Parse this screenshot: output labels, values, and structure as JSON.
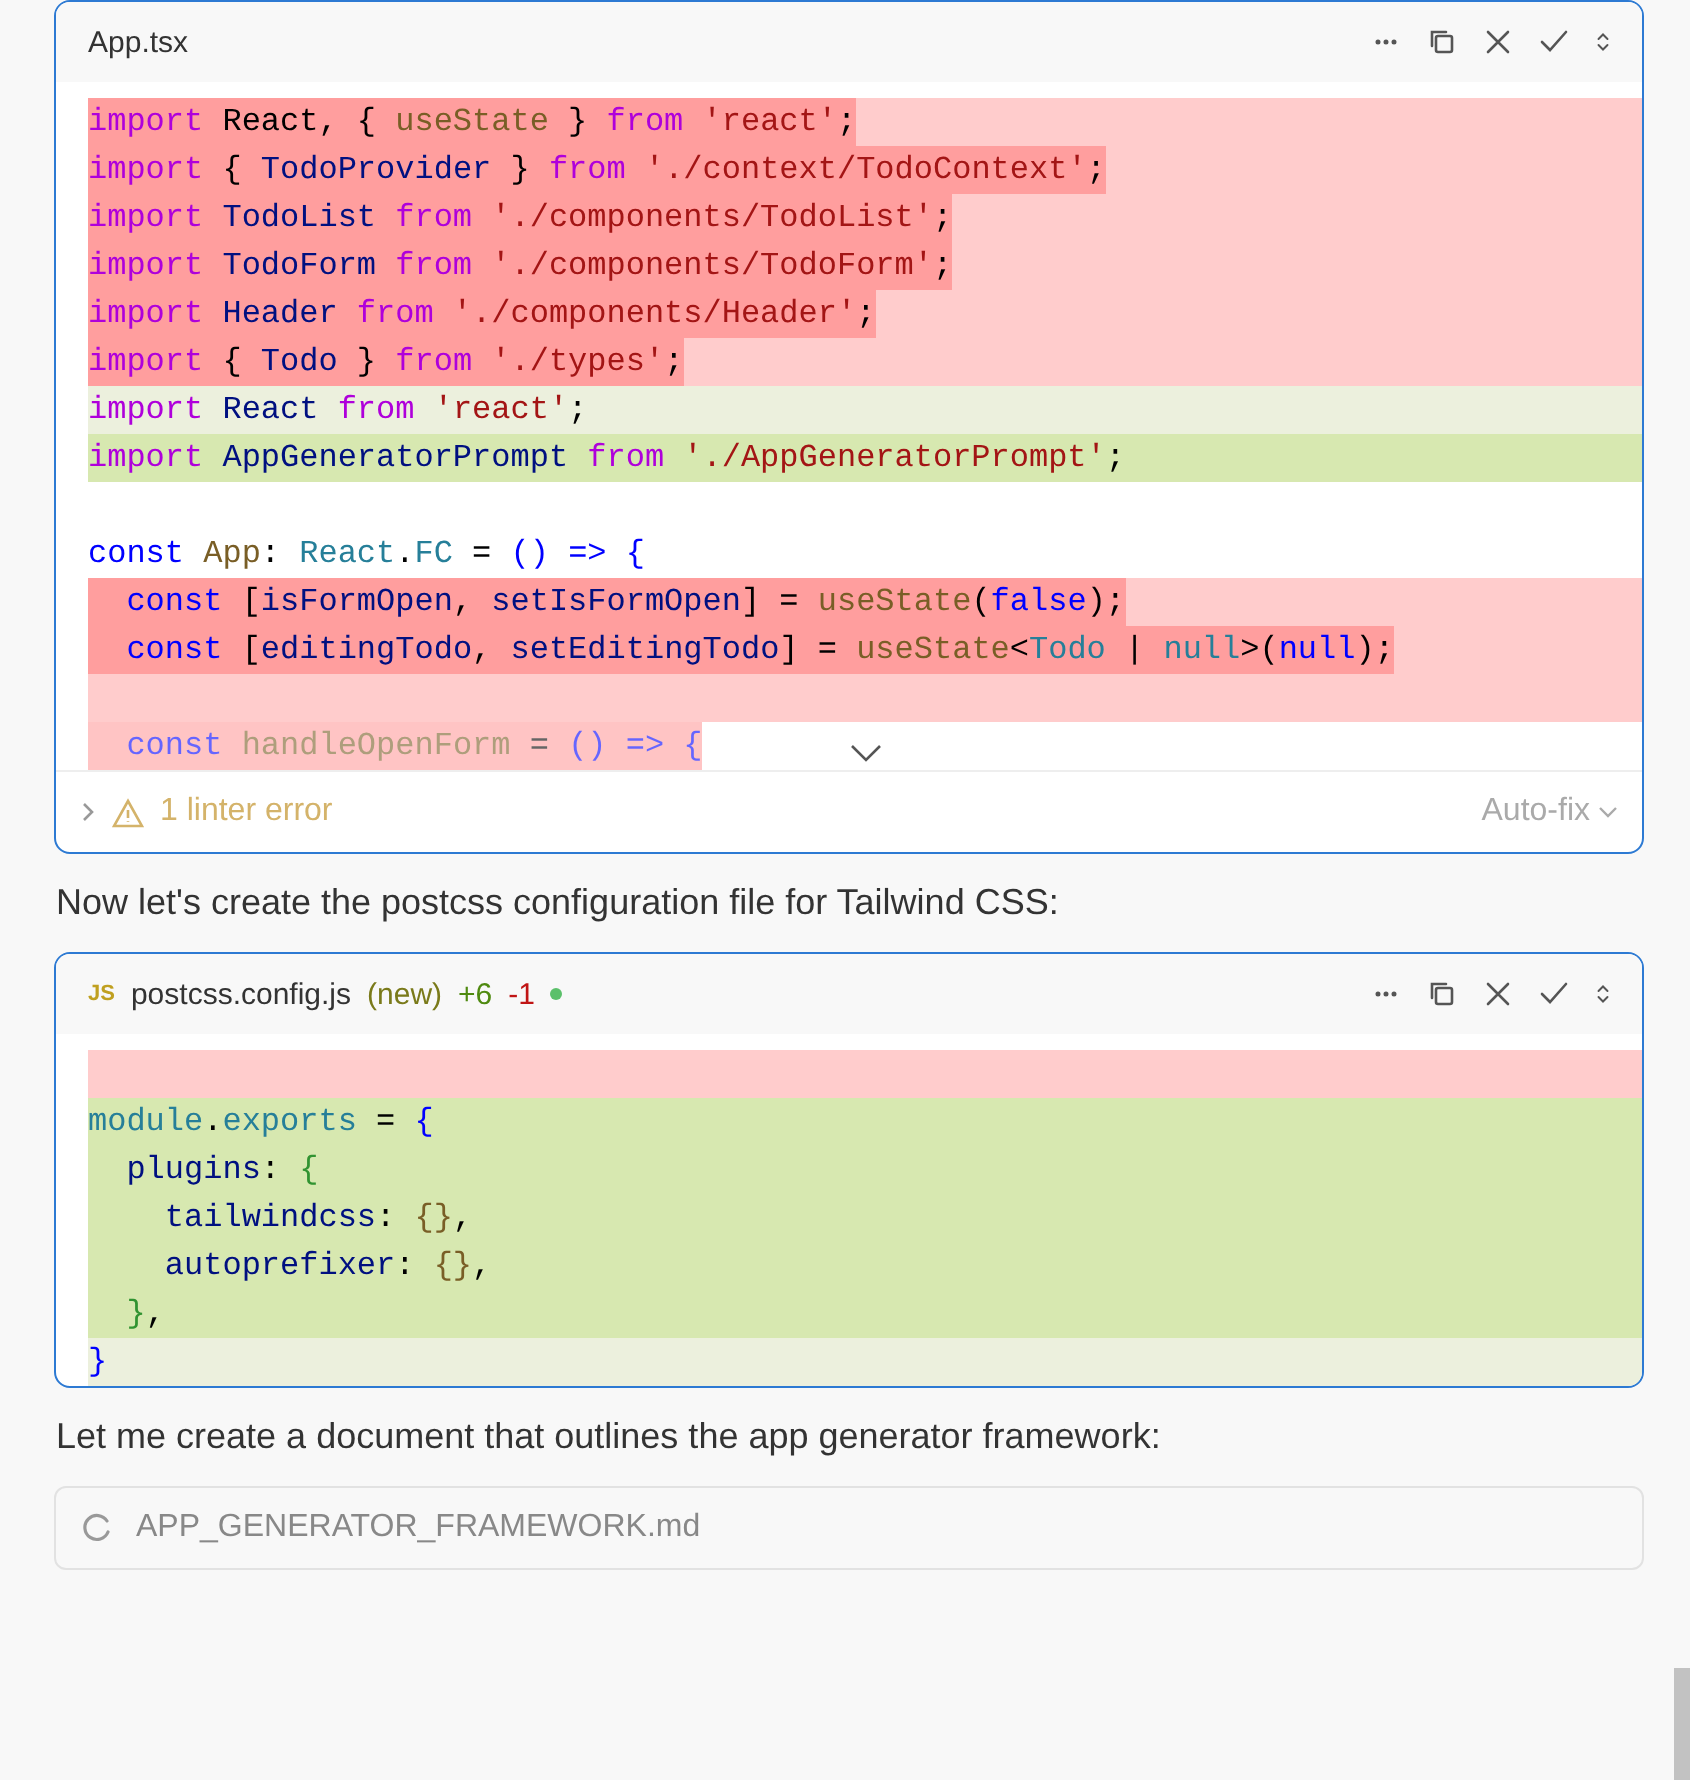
{
  "cards": [
    {
      "file": {
        "name": "App.tsx"
      },
      "lines": [
        {
          "kind": "removed",
          "tokens": [
            {
              "kind": "kw",
              "text": "import"
            },
            {
              "kind": "punc",
              "text": " React, { "
            },
            {
              "kind": "fn",
              "text": "useState"
            },
            {
              "kind": "punc",
              "text": " } "
            },
            {
              "kind": "kw",
              "text": "from"
            },
            {
              "kind": "str",
              "text": " 'react'"
            },
            {
              "kind": "punc",
              "text": ";"
            }
          ]
        },
        {
          "kind": "removed",
          "tokens": [
            {
              "kind": "kw",
              "text": "import"
            },
            {
              "kind": "punc",
              "text": " { "
            },
            {
              "kind": "id",
              "text": "TodoProvider"
            },
            {
              "kind": "punc",
              "text": " } "
            },
            {
              "kind": "kw",
              "text": "from"
            },
            {
              "kind": "str",
              "text": " './context/TodoContext'"
            },
            {
              "kind": "punc",
              "text": ";"
            }
          ]
        },
        {
          "kind": "removed",
          "tokens": [
            {
              "kind": "kw",
              "text": "import"
            },
            {
              "kind": "id",
              "text": " TodoList "
            },
            {
              "kind": "kw",
              "text": "from"
            },
            {
              "kind": "str",
              "text": " './components/TodoList'"
            },
            {
              "kind": "punc",
              "text": ";"
            }
          ]
        },
        {
          "kind": "removed",
          "tokens": [
            {
              "kind": "kw",
              "text": "import"
            },
            {
              "kind": "id",
              "text": " TodoForm "
            },
            {
              "kind": "kw",
              "text": "from"
            },
            {
              "kind": "str",
              "text": " './components/TodoForm'"
            },
            {
              "kind": "punc",
              "text": ";"
            }
          ]
        },
        {
          "kind": "removed",
          "tokens": [
            {
              "kind": "kw",
              "text": "import"
            },
            {
              "kind": "id",
              "text": " Header "
            },
            {
              "kind": "kw",
              "text": "from"
            },
            {
              "kind": "str",
              "text": " './components/Header'"
            },
            {
              "kind": "punc",
              "text": ";"
            }
          ]
        },
        {
          "kind": "removed",
          "tokens": [
            {
              "kind": "kw",
              "text": "import"
            },
            {
              "kind": "punc",
              "text": " { "
            },
            {
              "kind": "id",
              "text": "Todo"
            },
            {
              "kind": "punc",
              "text": " } "
            },
            {
              "kind": "kw",
              "text": "from"
            },
            {
              "kind": "str",
              "text": " './types'"
            },
            {
              "kind": "punc",
              "text": ";"
            }
          ]
        },
        {
          "kind": "modified",
          "tokens": [
            {
              "kind": "kw",
              "text": "import"
            },
            {
              "kind": "id",
              "text": " React "
            },
            {
              "kind": "kw",
              "text": "from"
            },
            {
              "kind": "str",
              "text": " 'react'"
            },
            {
              "kind": "punc",
              "text": ";"
            }
          ]
        },
        {
          "kind": "added",
          "tokens": [
            {
              "kind": "kw",
              "text": "import"
            },
            {
              "kind": "id",
              "text": " AppGeneratorPrompt "
            },
            {
              "kind": "kw",
              "text": "from"
            },
            {
              "kind": "str",
              "text": " './AppGeneratorPrompt'"
            },
            {
              "kind": "punc",
              "text": ";"
            }
          ]
        },
        {
          "kind": "context"
        },
        {
          "kind": "context",
          "tokens": [
            {
              "kind": "key",
              "text": "const"
            },
            {
              "kind": "fn",
              "text": " App"
            },
            {
              "kind": "punc",
              "text": ": "
            },
            {
              "kind": "type",
              "text": "React"
            },
            {
              "kind": "punc",
              "text": "."
            },
            {
              "kind": "type",
              "text": "FC"
            },
            {
              "kind": "punc",
              "text": " = "
            },
            {
              "kind": "key",
              "text": "() =>"
            },
            {
              "kind": "key",
              "text": " {"
            }
          ]
        },
        {
          "kind": "removed",
          "tokens": [
            {
              "kind": "key",
              "text": "  const"
            },
            {
              "kind": "punc",
              "text": " ["
            },
            {
              "kind": "id",
              "text": "isFormOpen"
            },
            {
              "kind": "punc",
              "text": ", "
            },
            {
              "kind": "id",
              "text": "setIsFormOpen"
            },
            {
              "kind": "punc",
              "text": "] = "
            },
            {
              "kind": "fn",
              "text": "useState"
            },
            {
              "kind": "punc",
              "text": "("
            },
            {
              "kind": "key",
              "text": "false"
            },
            {
              "kind": "punc",
              "text": ");"
            }
          ]
        },
        {
          "kind": "removed",
          "tokens": [
            {
              "kind": "key",
              "text": "  const"
            },
            {
              "kind": "punc",
              "text": " ["
            },
            {
              "kind": "id",
              "text": "editingTodo"
            },
            {
              "kind": "punc",
              "text": ", "
            },
            {
              "kind": "id",
              "text": "setEditingTodo"
            },
            {
              "kind": "punc",
              "text": "] = "
            },
            {
              "kind": "fn",
              "text": "useState"
            },
            {
              "kind": "punc",
              "text": "<"
            },
            {
              "kind": "type",
              "text": "Todo"
            },
            {
              "kind": "punc",
              "text": " | "
            },
            {
              "kind": "type",
              "text": "null"
            },
            {
              "kind": "punc",
              "text": ">("
            },
            {
              "kind": "key",
              "text": "null"
            },
            {
              "kind": "punc",
              "text": ");"
            }
          ]
        },
        {
          "kind": "removed"
        },
        {
          "kind": "removed",
          "faded": true,
          "tokens": [
            {
              "kind": "key",
              "text": "  const"
            },
            {
              "kind": "fn",
              "text": " handleOpenForm"
            },
            {
              "kind": "punc",
              "text": " = "
            },
            {
              "kind": "key",
              "text": "() => {"
            }
          ]
        }
      ],
      "footer": {
        "linter": "1 linter error",
        "action": "Auto-fix"
      }
    },
    {
      "file": {
        "badge": "JS",
        "name": "postcss.config.js",
        "status": "(new)",
        "added": "+6",
        "removed": "-1",
        "dot": true
      },
      "lines": [
        {
          "kind": "removed"
        },
        {
          "kind": "added",
          "tokens": [
            {
              "kind": "type",
              "text": "module"
            },
            {
              "kind": "punc",
              "text": "."
            },
            {
              "kind": "type",
              "text": "exports"
            },
            {
              "kind": "punc",
              "text": " = "
            },
            {
              "kind": "key",
              "text": "{"
            }
          ]
        },
        {
          "kind": "added",
          "tokens": [
            {
              "kind": "id",
              "text": "  plugins"
            },
            {
              "kind": "punc",
              "text": ": "
            },
            {
              "kind": "green",
              "text": "{"
            }
          ]
        },
        {
          "kind": "added",
          "tokens": [
            {
              "kind": "id",
              "text": "    tailwindcss"
            },
            {
              "kind": "punc",
              "text": ": "
            },
            {
              "kind": "fn",
              "text": "{}"
            },
            {
              "kind": "punc",
              "text": ","
            }
          ]
        },
        {
          "kind": "added",
          "tokens": [
            {
              "kind": "id",
              "text": "    autoprefixer"
            },
            {
              "kind": "punc",
              "text": ": "
            },
            {
              "kind": "fn",
              "text": "{}"
            },
            {
              "kind": "punc",
              "text": ","
            }
          ]
        },
        {
          "kind": "added",
          "tokens": [
            {
              "kind": "green",
              "text": "  }"
            },
            {
              "kind": "punc",
              "text": ","
            }
          ]
        },
        {
          "kind": "modified",
          "tokens": [
            {
              "kind": "key",
              "text": "}"
            }
          ]
        }
      ]
    }
  ],
  "messages": [
    "Now let's create the postcss configuration file for Tailwind CSS:",
    "Let me create a document that outlines the app generator framework:"
  ],
  "pending": {
    "name": "APP_GENERATOR_FRAMEWORK.md"
  }
}
